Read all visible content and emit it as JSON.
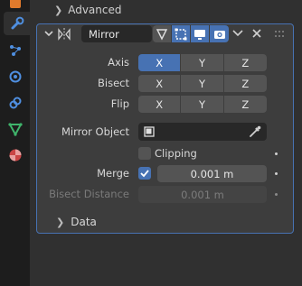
{
  "sidebar": {
    "active_tab": "wrench-icon"
  },
  "advanced": {
    "label": "Advanced"
  },
  "modifier": {
    "name": "Mirror",
    "axis": {
      "label": "Axis",
      "options": [
        "X",
        "Y",
        "Z"
      ]
    },
    "bisect": {
      "label": "Bisect",
      "options": [
        "X",
        "Y",
        "Z"
      ]
    },
    "flip": {
      "label": "Flip",
      "options": [
        "X",
        "Y",
        "Z"
      ]
    },
    "mirror_object": {
      "label": "Mirror Object",
      "value": ""
    },
    "clipping": {
      "label": "Clipping"
    },
    "merge": {
      "label": "Merge",
      "value": "0.001 m"
    },
    "bisect_distance": {
      "label": "Bisect Distance",
      "value": "0.001 m"
    },
    "data": {
      "label": "Data"
    }
  },
  "colors": {
    "accent": "#4772b3",
    "panel": "#3d3d3d",
    "background": "#303030"
  }
}
